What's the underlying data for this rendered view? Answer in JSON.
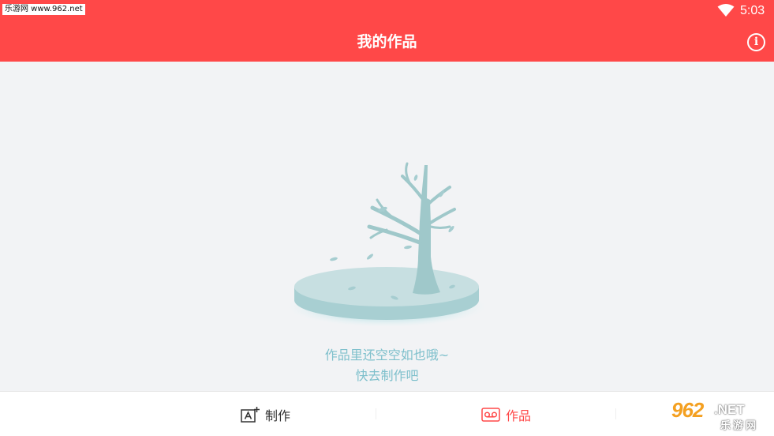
{
  "status_bar": {
    "watermark": "乐游网 www.962.net",
    "time": "5:03",
    "wifi_icon": "wifi-icon",
    "color": "#ff4848"
  },
  "header": {
    "title": "我的作品",
    "info_icon": "info-icon",
    "info_glyph": "i"
  },
  "empty_state": {
    "illustration": "bare-tree-icon",
    "line1": "作品里还空空如也哦~",
    "line2": "快去制作吧",
    "text_color": "#7fc0cc"
  },
  "bottom_nav": {
    "tabs": [
      {
        "label": "制作",
        "icon": "create-text-icon",
        "active": false
      },
      {
        "label": "作品",
        "icon": "cassette-icon",
        "active": true
      }
    ],
    "active_color": "#ff4848"
  },
  "logo_watermark": {
    "brand": "962",
    "suffix": ".NET",
    "cn": "乐游网"
  }
}
